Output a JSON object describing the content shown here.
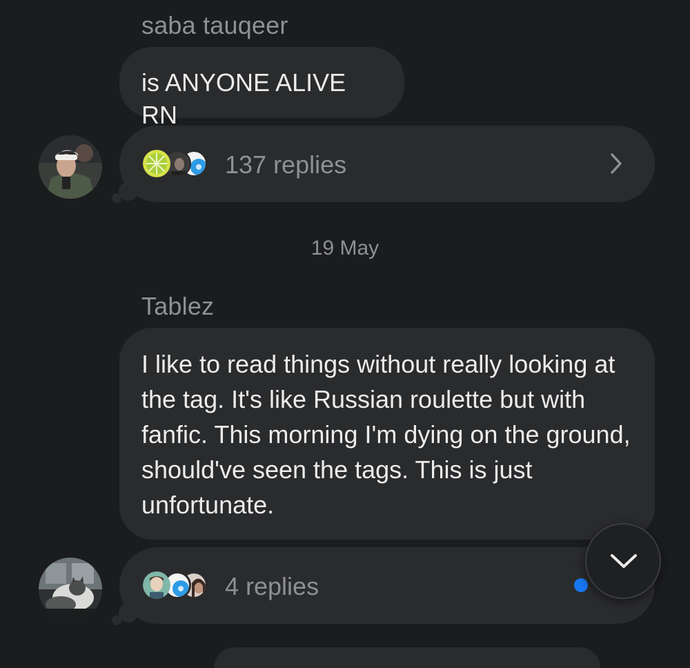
{
  "messages": [
    {
      "sender": "saba tauqeer",
      "text": "is ANYONE ALIVE RN",
      "thread": {
        "replies_label": "137 replies",
        "chevron_icon": "chevron-right-icon"
      }
    },
    {
      "sender": "Tablez",
      "text": "I like to read things without really looking at the tag. It's like Russian roulette but with fanfic. This morning I'm dying on the ground, should've seen the tags. This is just unfortunate.",
      "thread": {
        "replies_label": "4 replies",
        "unread": true
      }
    }
  ],
  "date_separator": "19 May",
  "scroll_button": {
    "icon": "chevron-down-icon"
  },
  "colors": {
    "background": "#1b1c1e",
    "bubble": "#2a2b2d",
    "muted_text": "#8f9094",
    "text": "#ececec",
    "unread_dot": "#1877f2"
  }
}
